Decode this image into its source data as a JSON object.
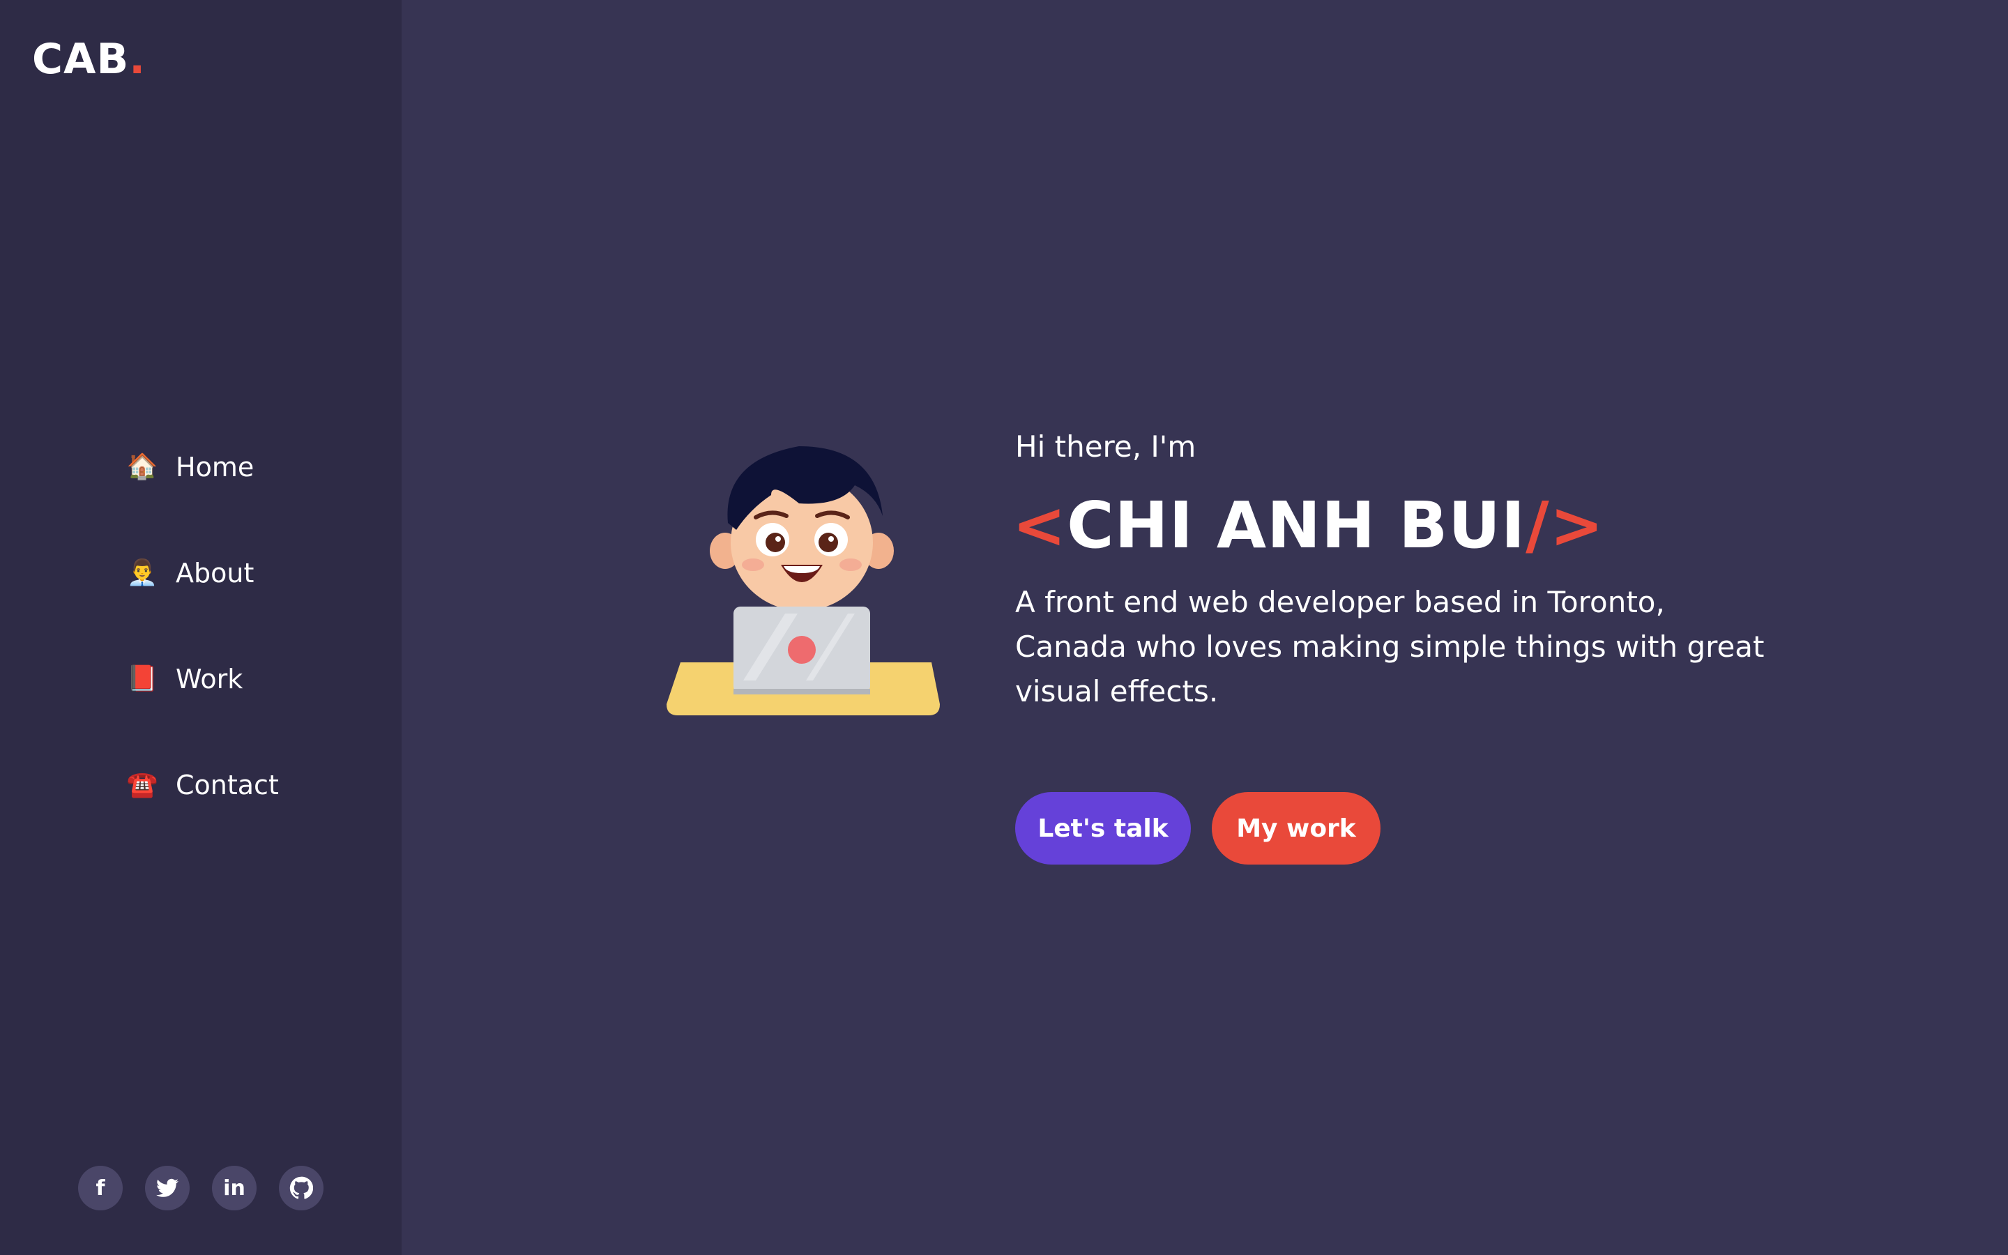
{
  "logo": {
    "text": "CAB",
    "dot": "."
  },
  "nav": {
    "items": [
      {
        "label": "Home",
        "icon": "house-icon",
        "emoji": "🏠"
      },
      {
        "label": "About",
        "icon": "person-icon",
        "emoji": "👨‍💼"
      },
      {
        "label": "Work",
        "icon": "book-icon",
        "emoji": "📕"
      },
      {
        "label": "Contact",
        "icon": "telephone-icon",
        "emoji": "☎️"
      }
    ]
  },
  "socials": [
    {
      "name": "facebook",
      "glyph": "f"
    },
    {
      "name": "twitter",
      "glyph": "🐦"
    },
    {
      "name": "linkedin",
      "glyph": "in"
    },
    {
      "name": "github",
      "glyph": "◉"
    }
  ],
  "hero": {
    "greeting": "Hi there, I'm",
    "name_open": "<",
    "name": "CHI ANH BUI",
    "name_close_slash": "/",
    "name_close": ">",
    "tagline": "A front end web developer based in Toronto, Canada who loves making simple things with great visual effects.",
    "cta_primary": "Let's talk",
    "cta_secondary": "My work"
  },
  "colors": {
    "background": "#373453",
    "sidebar": "#2e2b46",
    "accent_red": "#e9493a",
    "accent_purple": "#6541d9"
  }
}
